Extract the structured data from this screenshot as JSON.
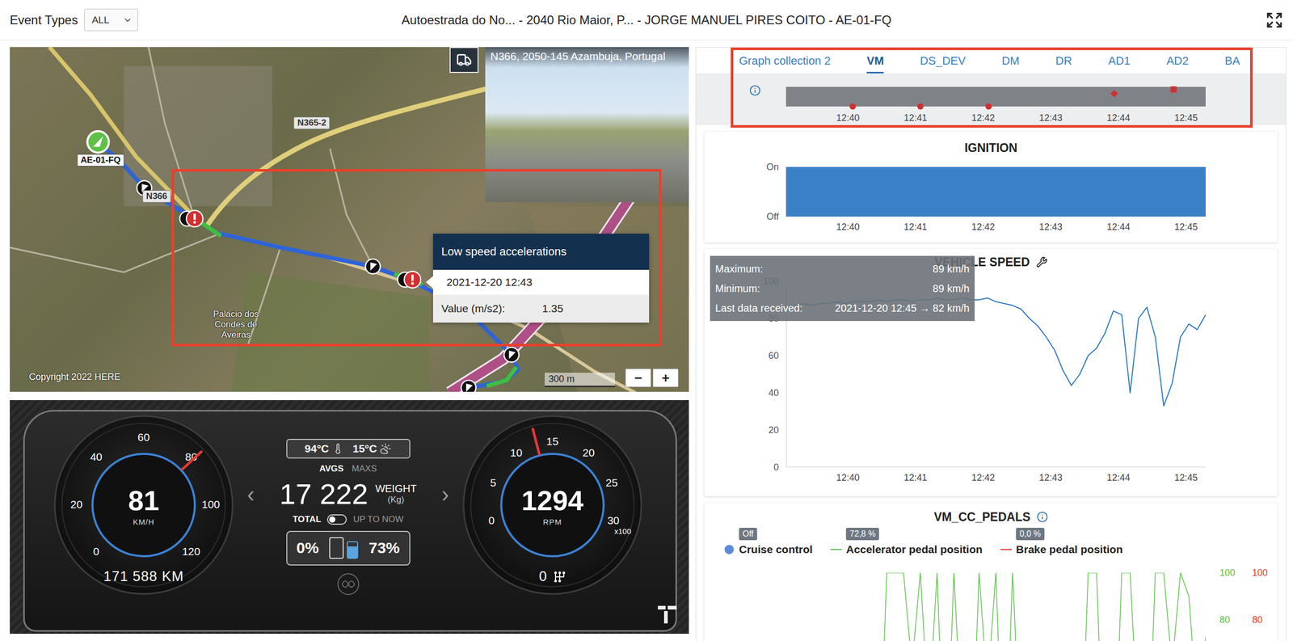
{
  "header": {
    "filter_label": "Event Types",
    "filter_value": "ALL",
    "title": "Autoestrada do No... - 2040 Rio Maior, P... - JORGE MANUEL PIRES COITO - AE-01-FQ"
  },
  "map": {
    "street_view": {
      "address": "N366, 2050-145 Azambuja, Portugal"
    },
    "vehicle": {
      "plate": "AE-01-FQ"
    },
    "road_labels": [
      "N365-2",
      "N366"
    ],
    "place_label": "Palácio dos Condes de Aveiras",
    "copyright": "Copyright 2022 HERE",
    "scale": "300 m",
    "zoom": [
      "−",
      "+"
    ],
    "markers": [
      {
        "kind": "direction"
      },
      {
        "kind": "direction"
      },
      {
        "kind": "direction"
      },
      {
        "kind": "direction"
      },
      {
        "kind": "event"
      },
      {
        "kind": "event"
      }
    ],
    "tooltip": {
      "title": "Low speed accelerations",
      "time": "2021-12-20 12:43",
      "label": "Value (m/s2):",
      "value": "1.35"
    }
  },
  "dashboard": {
    "speedometer": {
      "ticks": [
        "0",
        "20",
        "40",
        "60",
        "80",
        "100",
        "120"
      ],
      "value": "81",
      "unit": "KM/H",
      "level": 0.675,
      "odometer": "171 588 KM"
    },
    "tachometer": {
      "ticks": [
        "0",
        "5",
        "10",
        "15",
        "20",
        "25",
        "30"
      ],
      "multiplier": "x100",
      "value": "1294",
      "unit": "RPM",
      "level": 0.431,
      "gear": "0"
    },
    "temperatures": [
      {
        "kind": "engine",
        "value": "94°C"
      },
      {
        "kind": "outside",
        "value": "15°C"
      }
    ],
    "modes": [
      {
        "label": "AVGS",
        "selected": true
      },
      {
        "label": "MAXS",
        "selected": false
      }
    ],
    "prev": "‹",
    "next": "›",
    "weight": {
      "value": "17 222",
      "label": "WEIGHT",
      "unit": "(Kg)"
    },
    "totals": [
      {
        "label": "TOTAL",
        "selected": true
      },
      {
        "label": "UP TO NOW",
        "selected": false
      }
    ],
    "levels": [
      {
        "kind": "battery",
        "reading": "0%",
        "level": 0,
        "color": "#d9d9d9"
      },
      {
        "kind": "tank",
        "reading": "73%",
        "level": 0.73,
        "color": "#5ba4de"
      }
    ]
  },
  "graphs": {
    "tabs": [
      {
        "label": "Graph collection 2",
        "selected": false
      },
      {
        "label": "VM",
        "selected": true
      },
      {
        "label": "DS_DEV",
        "selected": false
      },
      {
        "label": "DM",
        "selected": false
      },
      {
        "label": "DR",
        "selected": false
      },
      {
        "label": "AD1",
        "selected": false
      },
      {
        "label": "AD2",
        "selected": false
      },
      {
        "label": "BA",
        "selected": false
      }
    ],
    "timeline": {
      "ticks": [
        "12:40",
        "12:41",
        "12:42",
        "12:43",
        "12:44",
        "12:45"
      ],
      "events": [
        {
          "kind": "dot",
          "at": 40.07
        },
        {
          "kind": "dot",
          "at": 41.07
        },
        {
          "kind": "dot",
          "at": 42.08
        },
        {
          "kind": "diamond",
          "at": 43.94
        },
        {
          "kind": "square",
          "at": 44.82
        }
      ]
    },
    "ignition": {
      "title": "IGNITION",
      "y_labels": [
        {
          "label": "On",
          "value": 1
        },
        {
          "label": "Off",
          "value": 0
        }
      ],
      "values": [
        1,
        1,
        1,
        1,
        1,
        1,
        1
      ],
      "ticks": [
        "12:40",
        "12:41",
        "12:42",
        "12:43",
        "12:44",
        "12:45"
      ]
    },
    "speed": {
      "title": "VEHICLE SPEED",
      "y_ticks": [
        "0",
        "20",
        "40",
        "60",
        "80",
        "100"
      ],
      "ticks": [
        "12:40",
        "12:41",
        "12:42",
        "12:43",
        "12:44",
        "12:45"
      ],
      "values": [
        86,
        87,
        88,
        87,
        88,
        88,
        89,
        88,
        89,
        89,
        89,
        90,
        89,
        90,
        90,
        89,
        90,
        90,
        91,
        90,
        90,
        91,
        90,
        90,
        91,
        89,
        88,
        87,
        85,
        80,
        76,
        70,
        63,
        52,
        44,
        50,
        60,
        64,
        72,
        84,
        82,
        40,
        80,
        86,
        70,
        33,
        45,
        70,
        77,
        74,
        82
      ],
      "tooltip": [
        {
          "label": "Maximum:",
          "value": "89 km/h"
        },
        {
          "label": "Minimum:",
          "value": "89 km/h"
        },
        {
          "label": "Last data received:",
          "value": "2021-12-20 12:45 → 82 km/h"
        }
      ]
    },
    "pedals": {
      "title": "VM_CC_PEDALS",
      "legend": [
        {
          "kind": "dot",
          "label": "Cruise control",
          "badge": "Off",
          "color": "#5b8dd6"
        },
        {
          "kind": "line",
          "label": "Accelerator pedal position",
          "badge": "72,8 %",
          "color": "#5cc04b"
        },
        {
          "kind": "line",
          "label": "Brake pedal position",
          "badge": "0,0 %",
          "color": "#e53935"
        }
      ],
      "axes": [
        {
          "color": "#5cc04b",
          "ticks": [
            "100",
            "80"
          ]
        },
        {
          "color": "#e53935",
          "ticks": [
            "100",
            "80"
          ]
        }
      ],
      "accelerator": [
        0,
        0,
        0,
        0,
        0,
        0,
        0,
        0,
        0,
        0,
        0,
        0,
        100,
        100,
        100,
        60,
        100,
        40,
        100,
        0,
        100,
        30,
        0,
        100,
        50,
        100,
        0,
        100,
        20,
        0,
        0,
        0,
        0,
        0,
        0,
        0,
        100,
        100,
        0,
        0,
        100,
        100,
        30,
        0,
        100,
        100,
        60,
        100,
        90,
        40,
        72.8
      ],
      "brake": [
        0,
        0,
        0,
        0,
        0,
        0,
        0,
        0,
        0,
        0,
        0
      ]
    }
  }
}
